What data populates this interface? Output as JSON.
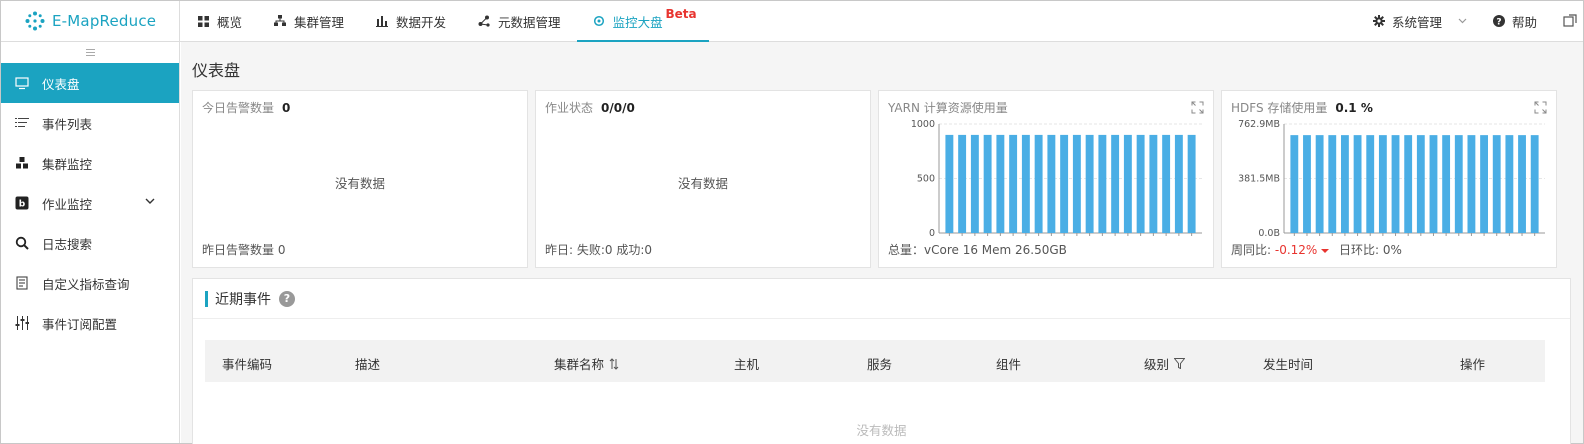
{
  "app": {
    "name": "E-MapReduce"
  },
  "nav": [
    {
      "label": "概览",
      "icon": "grid-icon"
    },
    {
      "label": "集群管理",
      "icon": "cluster-icon"
    },
    {
      "label": "数据开发",
      "icon": "bar-chart-icon"
    },
    {
      "label": "元数据管理",
      "icon": "nodes-icon"
    },
    {
      "label": "监控大盘",
      "icon": "monitor-icon",
      "badge": "Beta",
      "active": true
    }
  ],
  "nav_right": {
    "settings": "系统管理",
    "help": "帮助"
  },
  "sidebar": [
    {
      "label": "仪表盘",
      "icon": "monitor-icon",
      "active": true
    },
    {
      "label": "事件列表",
      "icon": "list-icon"
    },
    {
      "label": "集群监控",
      "icon": "cluster-icon"
    },
    {
      "label": "作业监控",
      "icon": "job-icon"
    },
    {
      "label": "日志搜索",
      "icon": "search-icon"
    },
    {
      "label": "自定义指标查询",
      "icon": "query-icon"
    },
    {
      "label": "事件订阅配置",
      "icon": "settings-sliders-icon"
    }
  ],
  "page": {
    "title": "仪表盘"
  },
  "cards": {
    "alarms": {
      "title": "今日告警数量",
      "value": "0",
      "nodata": "没有数据",
      "footer": "昨日告警数量 0"
    },
    "jobs": {
      "title": "作业状态",
      "value": "0/0/0",
      "nodata": "没有数据",
      "footer": "昨日: 失败:0 成功:0"
    },
    "yarn": {
      "title": "YARN 计算资源使用量",
      "footer": "总量：vCore 16 Mem 26.50GB"
    },
    "hdfs": {
      "title": "HDFS 存储使用量",
      "value": "0.1 %",
      "footer_prefix": "周同比:",
      "wow": "-0.12%",
      "footer_suffix": "日环比: 0%"
    }
  },
  "events": {
    "title": "近期事件",
    "columns": [
      "事件编码",
      "描述",
      "集群名称",
      "主机",
      "服务",
      "组件",
      "级别",
      "发生时间",
      "操作"
    ],
    "empty": "没有数据"
  },
  "colors": {
    "accent": "#1ba3c1",
    "bar": "#4aaee5",
    "negative": "#e8342f"
  },
  "chart_data": [
    {
      "type": "bar",
      "name": "yarn",
      "ylim": [
        0,
        1000
      ],
      "yticks": [
        "0",
        "500",
        "1000"
      ],
      "values": [
        900,
        900,
        900,
        900,
        900,
        900,
        900,
        900,
        900,
        900,
        900,
        900,
        900,
        900,
        900,
        900,
        900,
        900,
        900,
        900
      ]
    },
    {
      "type": "bar",
      "name": "hdfs",
      "ylim": [
        0,
        762.9
      ],
      "yticks": [
        "0.0B",
        "381.5MB",
        "762.9MB"
      ],
      "values": [
        685,
        685,
        685,
        685,
        685,
        685,
        685,
        685,
        685,
        685,
        685,
        685,
        685,
        685,
        685,
        685,
        685,
        685,
        685,
        685
      ]
    }
  ]
}
